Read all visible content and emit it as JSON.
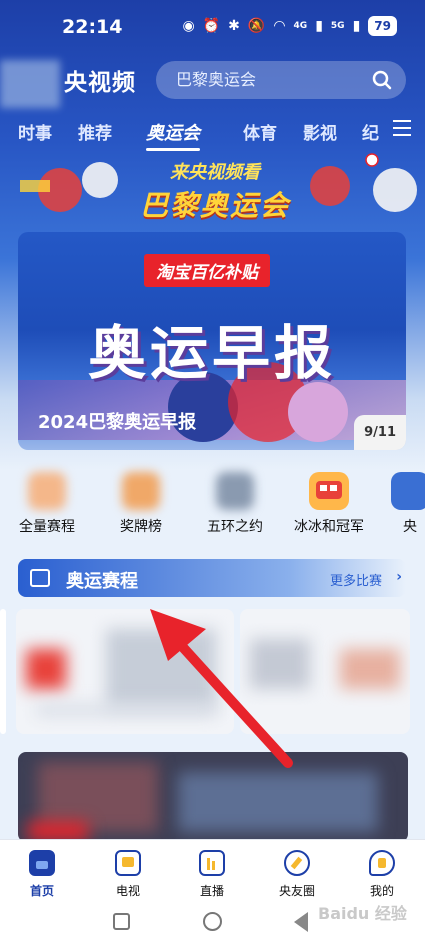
{
  "status_bar": {
    "time": "22:14",
    "battery": "79",
    "net1": "4G",
    "net2": "5G"
  },
  "header": {
    "app_name": "央视频",
    "search_placeholder": "巴黎奥运会"
  },
  "tabs": [
    {
      "label": "时事"
    },
    {
      "label": "推荐"
    },
    {
      "label": "奥运会"
    },
    {
      "label": "体育"
    },
    {
      "label": "影视"
    },
    {
      "label": "纪"
    }
  ],
  "active_tab": "奥运会",
  "hero": {
    "line1": "来央视频看",
    "line2": "巴黎奥运会"
  },
  "banner": {
    "tag": "淘宝百亿补贴",
    "headline": "奥运早报",
    "caption": "2024巴黎奥运早报",
    "counter": "9/11"
  },
  "shortcuts": [
    {
      "label": "全量赛程",
      "color": "#f4b78a"
    },
    {
      "label": "奖牌榜",
      "color": "#f0a868"
    },
    {
      "label": "五环之约",
      "color": "#8a9ab0"
    },
    {
      "label": "冰冰和冠军",
      "color": "#f05a3a"
    },
    {
      "label": "央",
      "color": "#3a6fd3"
    }
  ],
  "schedule": {
    "title": "奥运赛程",
    "more": "更多比赛"
  },
  "bottom_nav": [
    {
      "label": "首页",
      "icon": "home-icon"
    },
    {
      "label": "电视",
      "icon": "tv-icon"
    },
    {
      "label": "直播",
      "icon": "live-icon"
    },
    {
      "label": "央友圈",
      "icon": "compass-icon"
    },
    {
      "label": "我的",
      "icon": "profile-icon"
    }
  ],
  "watermark": "Baidu 经验",
  "colors": {
    "brand_blue": "#1d3fa8",
    "arrow_red": "#e8232b"
  }
}
